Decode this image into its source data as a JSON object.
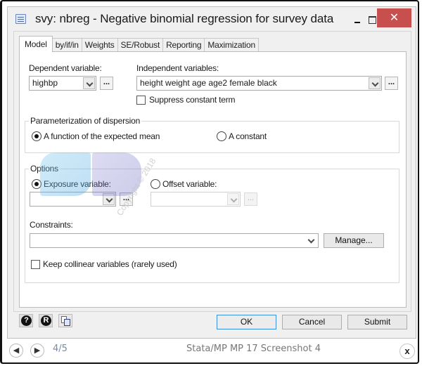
{
  "window": {
    "title": "svy: nbreg - Negative binomial regression for survey data",
    "close_glyph": "✕"
  },
  "tabs": [
    {
      "label": "Model",
      "active": true
    },
    {
      "label": "by/if/in",
      "active": false
    },
    {
      "label": "Weights",
      "active": false
    },
    {
      "label": "SE/Robust",
      "active": false
    },
    {
      "label": "Reporting",
      "active": false
    },
    {
      "label": "Maximization",
      "active": false
    }
  ],
  "model": {
    "dependent_label": "Dependent variable:",
    "dependent_value": "highbp",
    "independent_label": "Independent variables:",
    "independent_value": "height weight age age2 female black",
    "ellipsis": "...",
    "suppress_constant_label": "Suppress constant term",
    "suppress_constant_checked": false
  },
  "dispersion": {
    "title": "Parameterization of dispersion",
    "options": [
      {
        "label": "A function of the expected mean",
        "checked": true
      },
      {
        "label": "A constant",
        "checked": false
      }
    ]
  },
  "options": {
    "title": "Options",
    "exposure_label": "Exposure variable:",
    "exposure_checked": true,
    "exposure_value": "",
    "offset_label": "Offset variable:",
    "offset_checked": false,
    "offset_value": "",
    "constraints_label": "Constraints:",
    "constraints_value": "",
    "manage_label": "Manage...",
    "collinear_label": "Keep collinear variables (rarely used)",
    "collinear_checked": false
  },
  "footer": {
    "help_icon_glyph": "?",
    "reset_icon_glyph": "R",
    "ok_label": "OK",
    "cancel_label": "Cancel",
    "submit_label": "Submit"
  },
  "viewer": {
    "prev_glyph": "◀",
    "next_glyph": "▶",
    "pager": "4/5",
    "caption": "Stata/MP MP 17 Screenshot 4",
    "close_glyph": "x"
  },
  "watermark": {
    "text": "Copyright © 2018"
  }
}
